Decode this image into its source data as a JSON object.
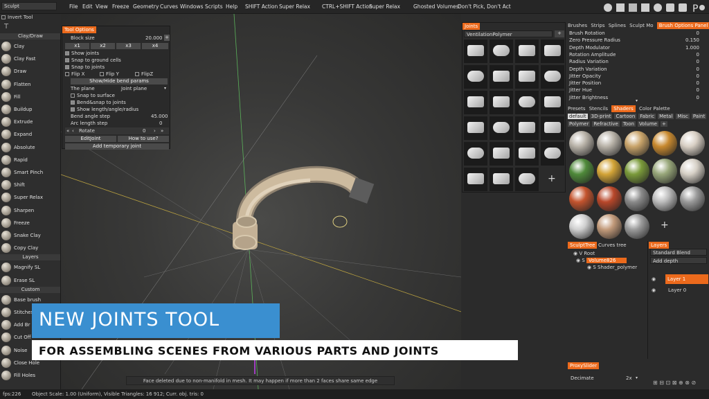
{
  "topbar": {
    "mode": "Sculpt",
    "invert_tool": "Invert Tool",
    "menu": [
      "File",
      "Edit",
      "View",
      "Freeze",
      "Geometry",
      "Curves",
      "Windows",
      "Scripts",
      "Help"
    ],
    "shift_action": "SHIFT Action",
    "shift_value": "Super Relax",
    "ctrl_shift_action": "CTRL+SHIFT Action",
    "ctrl_shift_value": "Super Relax",
    "ghosted_label": "Ghosted Volumes:",
    "ghosted_value": "Don't Pick, Don't Act"
  },
  "left_panel": {
    "section_claydraw": "Clay/Draw",
    "tools": [
      "Clay",
      "Clay Fast",
      "Draw",
      "Flatten",
      "Fill",
      "Buildup",
      "Extrude",
      "Expand",
      "Absolute",
      "Rapid",
      "Smart Pinch",
      "Shift",
      "Super Relax",
      "Sharpen",
      "Freeze",
      "Snake Clay",
      "Copy Clay"
    ],
    "section_layers": "Layers",
    "layer_tools": [
      "Magnify SL",
      "Erase SL"
    ],
    "section_custom": "Custom",
    "custom_tools": [
      "Base brush",
      "Stitches",
      "Add Br"
    ],
    "extra_tools": [
      "Cut Off",
      "Noise",
      "Close Hole",
      "Fill Holes"
    ]
  },
  "tool_options": {
    "tab": "Tool Options",
    "block_size_label": "Block size",
    "block_size_value": "20.000",
    "scales": [
      "x1",
      "x2",
      "x3",
      "x4"
    ],
    "show_joints": "Show joints",
    "snap_ground": "Snap to ground cells",
    "snap_joints": "Snap to joints",
    "flip_x": "Flip X",
    "flip_y": "Flip Y",
    "flip_z": "FlipZ",
    "bend_params": "Show/Hide bend params",
    "plane_label": "The plane",
    "plane_value": "Joint plane",
    "snap_surface": "Snap to surface",
    "bend_snap": "Bend&snap to joints",
    "show_length": "Show length/angle/radius",
    "bend_angle_label": "Bend angle step",
    "bend_angle_value": "45.000",
    "arc_len_label": "Arc length step",
    "arc_len_value": "0",
    "rotate_label": "Rotate",
    "rotate_value": "0",
    "edit_joint": "EditJoint",
    "how_to_use": "How to use?",
    "add_temp_joint": "Add temporary joint"
  },
  "joints_panel": {
    "tab": "Joints",
    "category": "VentilationPolymer",
    "add": "+"
  },
  "brush_options": {
    "tabs": [
      "Brushes",
      "Strips",
      "Splines",
      "Sculpt Mo"
    ],
    "active_tab": "Brush Options Panel",
    "rows": [
      {
        "label": "Brush Rotation",
        "value": "0"
      },
      {
        "label": "Zero Pressure Radius",
        "value": "0.150"
      },
      {
        "label": "Depth Modulator",
        "value": "1.000"
      },
      {
        "label": "Rotation Amplitude",
        "value": "0"
      },
      {
        "label": "Radius Variation",
        "value": "0"
      },
      {
        "label": "Depth Variation",
        "value": "0"
      },
      {
        "label": "Jitter Opacity",
        "value": "0"
      },
      {
        "label": "Jitter Position",
        "value": "0"
      },
      {
        "label": "Jitter Hue",
        "value": "0"
      },
      {
        "label": "Jitter Brightness",
        "value": "0"
      }
    ]
  },
  "shaders_panel": {
    "tabs": [
      "Presets",
      "Stencils"
    ],
    "active_tab": "Shaders",
    "tab_color": "Color Palette",
    "cats_row1": [
      "default",
      "3D-print",
      "Cartoon",
      "Fabric",
      "Metal",
      "Misc",
      "Paint"
    ],
    "cats_row2": [
      "Polymer",
      "Refractive",
      "Toon",
      "Volume",
      "+"
    ],
    "add": "+"
  },
  "sculpt_tree": {
    "tab": "SculptTree",
    "tab2": "Curves tree",
    "root": "Root",
    "volume": "Volume826",
    "shader": "Shader_polymer"
  },
  "layers_panel": {
    "tab": "Layers",
    "blend": "Standard Blend",
    "add_depth": "Add depth",
    "layer1": "Layer 1",
    "layer0": "Layer 0"
  },
  "proxy": {
    "tab": "ProxySlider",
    "decimate": "Decimate",
    "factor": "2x"
  },
  "banners": {
    "title": "NEW JOINTS TOOL",
    "subtitle": "FOR ASSEMBLING SCENES FROM VARIOUS PARTS AND JOINTS"
  },
  "status_message": "Face deleted due to non-manifold in mesh. It may happen if more than 2 faces share same edge",
  "bottom_bar": {
    "fps": "fps:226",
    "info": "Object Scale: 1.00 (Uniform), Visible Triangles: 16 912; Curr. obj. tris: 0"
  }
}
